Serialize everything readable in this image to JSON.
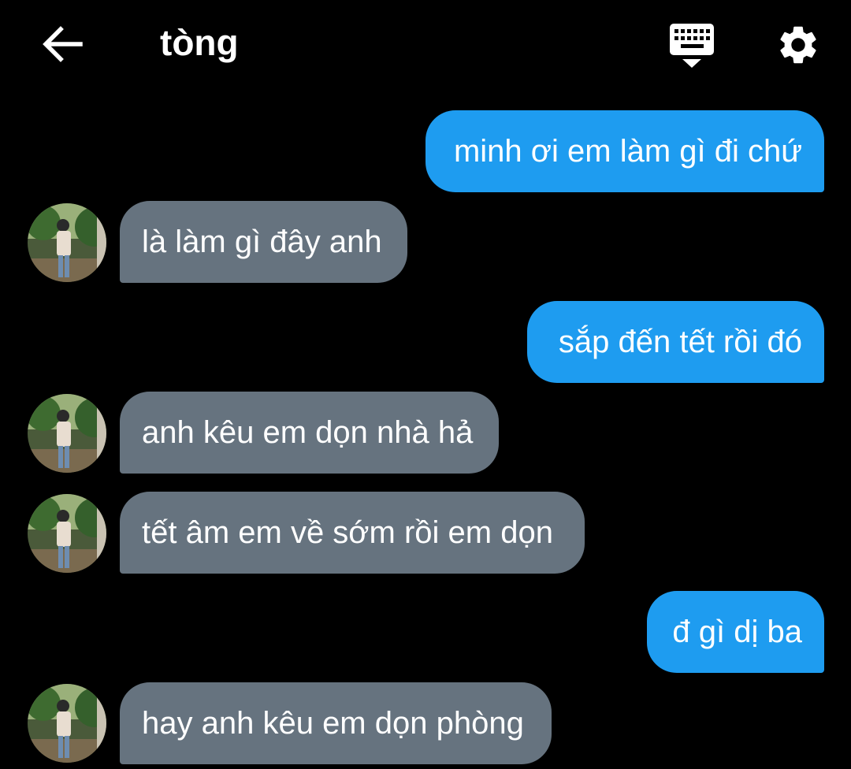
{
  "header": {
    "title": "tòng",
    "back_icon": "arrow-left-icon",
    "keyboard_icon": "keyboard-hide-icon",
    "settings_icon": "gear-icon"
  },
  "colors": {
    "background": "#000000",
    "outgoing_bubble": "#1e9cf0",
    "incoming_bubble": "#66737f",
    "text": "#ffffff"
  },
  "messages": [
    {
      "direction": "outgoing",
      "text": "minh ơi em làm gì đi chứ"
    },
    {
      "direction": "incoming",
      "text": "là làm gì đây anh"
    },
    {
      "direction": "outgoing",
      "text": "sắp đến tết rồi đó"
    },
    {
      "direction": "incoming",
      "text": "anh kêu em dọn nhà hả"
    },
    {
      "direction": "incoming",
      "text": "tết âm em về sớm rồi em dọn"
    },
    {
      "direction": "outgoing",
      "text": "đ gì dị ba"
    },
    {
      "direction": "incoming",
      "text": "hay anh kêu em dọn phòng"
    }
  ]
}
